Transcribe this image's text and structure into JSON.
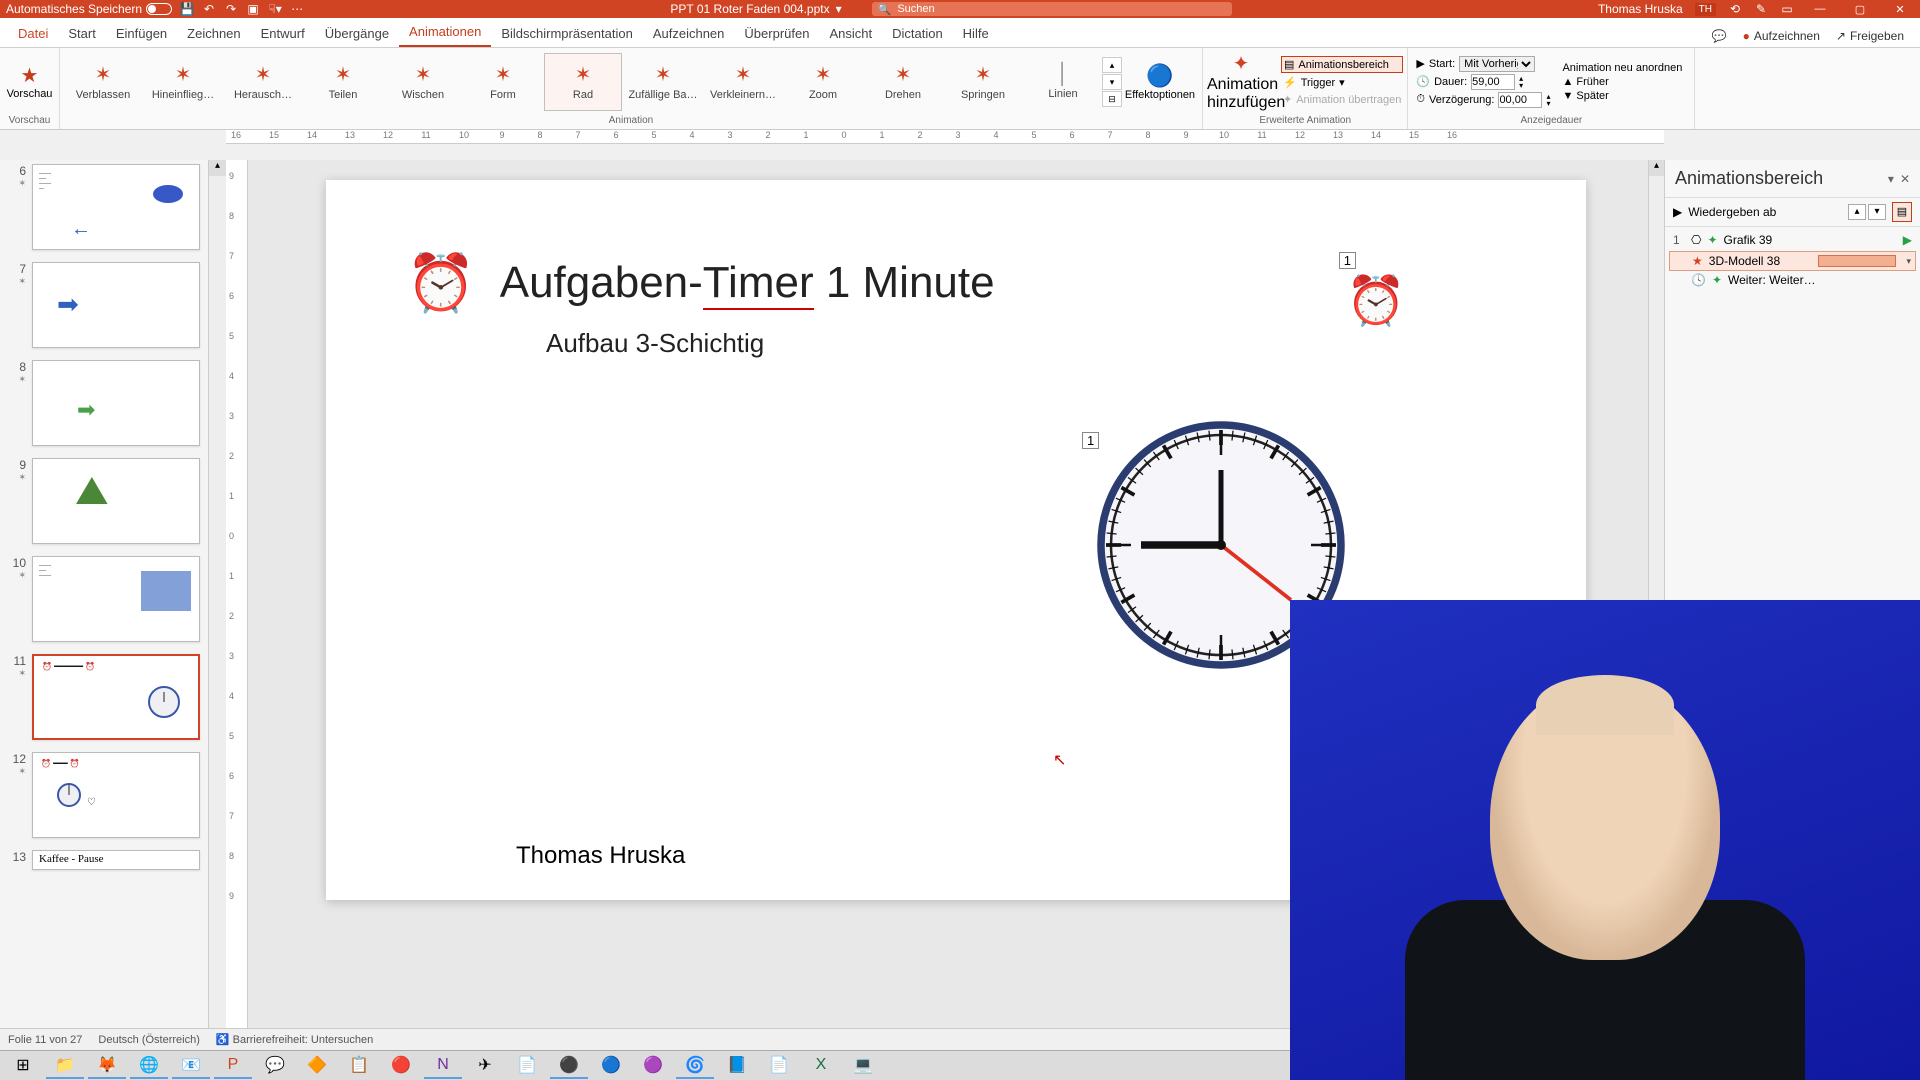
{
  "titlebar": {
    "autosave": "Automatisches Speichern",
    "filename": "PPT 01 Roter Faden 004.pptx",
    "search_placeholder": "Suchen",
    "user_name": "Thomas Hruska",
    "user_initials": "TH"
  },
  "tabs": {
    "file": "Datei",
    "items": [
      "Start",
      "Einfügen",
      "Zeichnen",
      "Entwurf",
      "Übergänge",
      "Animationen",
      "Bildschirmpräsentation",
      "Aufzeichnen",
      "Überprüfen",
      "Ansicht",
      "Dictation",
      "Hilfe"
    ],
    "active_index": 5,
    "record": "Aufzeichnen",
    "share": "Freigeben"
  },
  "ribbon": {
    "preview": {
      "label": "Vorschau",
      "group": "Vorschau"
    },
    "gallery": {
      "items": [
        "Verblassen",
        "Hineinflieg…",
        "Herausch…",
        "Teilen",
        "Wischen",
        "Form",
        "Rad",
        "Zufällige Ba…",
        "Verkleinern…",
        "Zoom",
        "Drehen",
        "Springen",
        "Linien"
      ],
      "selected_index": 6,
      "group": "Animation"
    },
    "effect_options": "Effektoptionen",
    "advanced": {
      "add": "Animation hinzufügen",
      "pane": "Animationsbereich",
      "trigger": "Trigger",
      "painter": "Animation übertragen",
      "group": "Erweiterte Animation"
    },
    "timing": {
      "start_lbl": "Start:",
      "start_val": "Mit Vorheriger",
      "duration_lbl": "Dauer:",
      "duration_val": "59,00",
      "delay_lbl": "Verzögerung:",
      "delay_val": "00,00",
      "reorder_title": "Animation neu anordnen",
      "earlier": "Früher",
      "later": "Später",
      "group": "Anzeigedauer"
    }
  },
  "thumbs": {
    "visible": [
      {
        "n": 6
      },
      {
        "n": 7
      },
      {
        "n": 8
      },
      {
        "n": 9
      },
      {
        "n": 10
      },
      {
        "n": 11,
        "active": true
      },
      {
        "n": 12
      },
      {
        "n": 13,
        "title": "Kaffee - Pause"
      }
    ]
  },
  "slide": {
    "title": "Aufgaben-Timer 1 Minute",
    "title_underline_word": "Timer",
    "subtitle": "Aufbau 3-Schichtig",
    "badge1": "1",
    "badge2": "1",
    "author": "Thomas Hruska"
  },
  "anim_pane": {
    "title": "Animationsbereich",
    "play": "Wiedergeben ab",
    "items": [
      {
        "n": "1",
        "icon": "✦",
        "icon_color": "#28a048",
        "name": "Grafik 39",
        "play_ico": "▶",
        "play_color": "#28a048"
      },
      {
        "n": "",
        "icon": "★",
        "icon_color": "#d04424",
        "name": "3D-Modell 38",
        "selected": true,
        "bar": true
      },
      {
        "n": "",
        "icon": "🕓",
        "icon_color": "#666",
        "name": "Weiter: Weiter…"
      }
    ]
  },
  "status": {
    "slide": "Folie 11 von 27",
    "lang": "Deutsch (Österreich)",
    "access": "Barrierefreiheit: Untersuchen"
  },
  "ruler_h": [
    16,
    15,
    14,
    13,
    12,
    11,
    10,
    9,
    8,
    7,
    6,
    5,
    4,
    3,
    2,
    1,
    0,
    1,
    2,
    3,
    4,
    5,
    6,
    7,
    8,
    9,
    10,
    11,
    12,
    13,
    14,
    15,
    16
  ],
  "ruler_v": [
    9,
    8,
    7,
    6,
    5,
    4,
    3,
    2,
    1,
    0,
    1,
    2,
    3,
    4,
    5,
    6,
    7,
    8,
    9
  ]
}
